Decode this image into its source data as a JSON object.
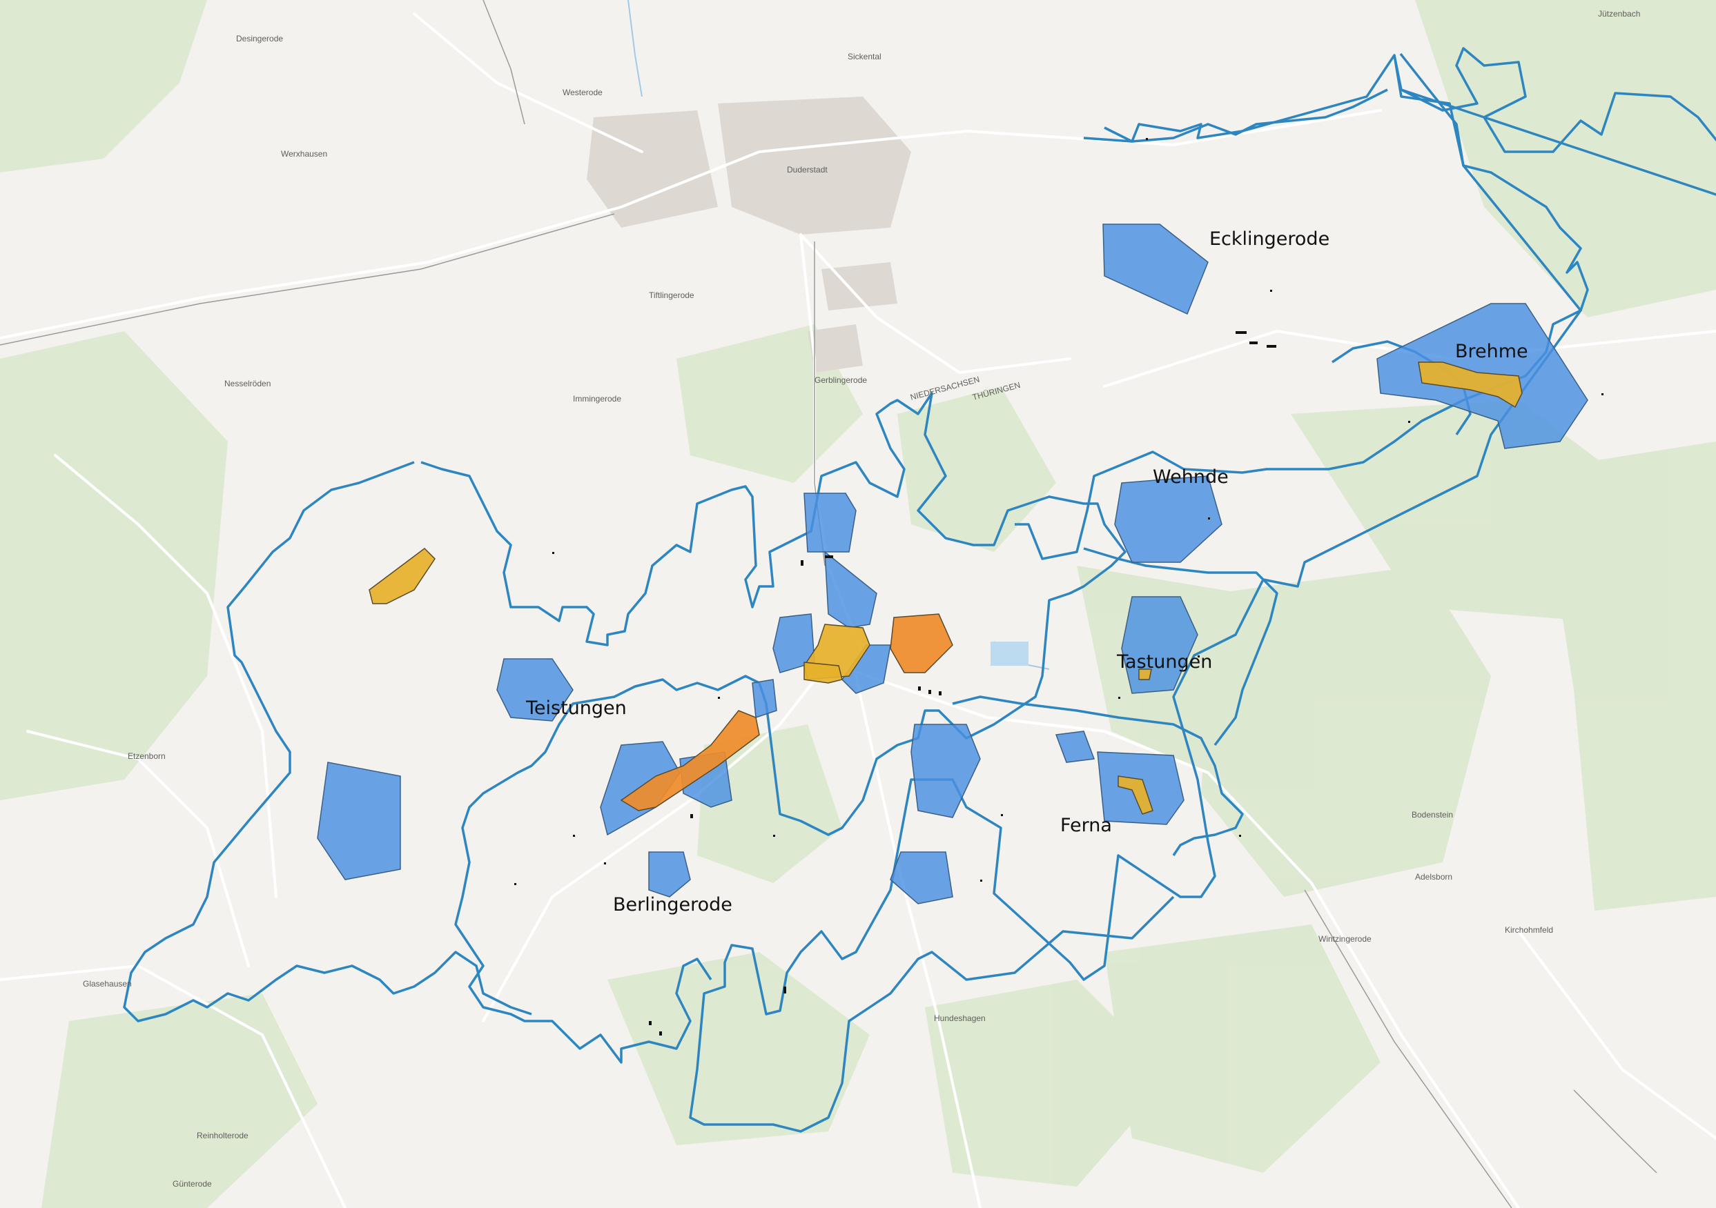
{
  "colors": {
    "boundary": "#2e86c1",
    "settlement_fill": "#4a90e2",
    "yellow_fill": "#e6b12a",
    "orange_fill": "#ef8c2a",
    "forest": "#d9e7cc",
    "road": "#ffffff",
    "background": "#f3f2ee"
  },
  "places": {
    "ecklingerode": "Ecklingerode",
    "brehme": "Brehme",
    "wehnde": "Wehnde",
    "tastungen": "Tastungen",
    "teistungen": "Teistungen",
    "ferna": "Ferna",
    "berlingerode": "Berlingerode"
  },
  "basemap_labels": {
    "duderstadt": "Duderstadt",
    "westerode": "Westerode",
    "werxhausen": "Werxhausen",
    "desingerode": "Desingerode",
    "nesselroden": "Nesselröden",
    "tiftlingerode": "Tiftlingerode",
    "immingerode": "Immingerode",
    "gerblingerode": "Gerblingerode",
    "etzenborn": "Etzenborn",
    "glasehausen": "Glasehausen",
    "hundeshagen": "Hundeshagen",
    "bodenstein": "Bodenstein",
    "adelsborn": "Adelsborn",
    "wintzingerode": "Wintzingerode",
    "kirchohmfeld": "Kirchohmfeld",
    "reinholterode": "Reinholterode",
    "guenterode": "Günterode",
    "juetzenbach": "Jützenbach",
    "sickental": "Sickental",
    "niedersachsen": "NIEDERSACHSEN",
    "thueringen": "THÜRINGEN"
  }
}
